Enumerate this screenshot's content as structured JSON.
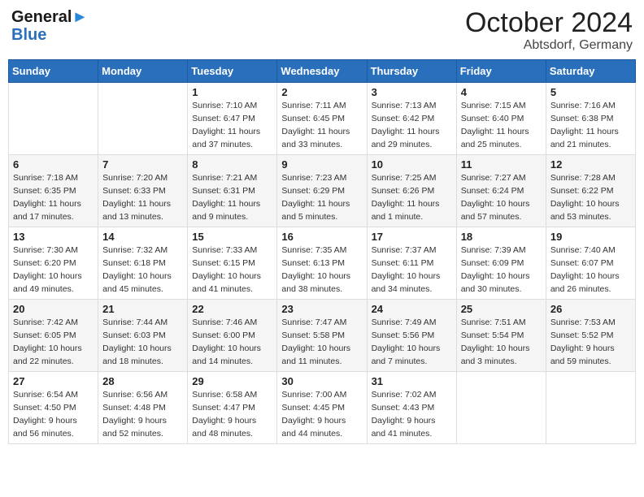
{
  "header": {
    "logo_general": "General",
    "logo_blue": "Blue",
    "month": "October 2024",
    "location": "Abtsdorf, Germany"
  },
  "weekdays": [
    "Sunday",
    "Monday",
    "Tuesday",
    "Wednesday",
    "Thursday",
    "Friday",
    "Saturday"
  ],
  "weeks": [
    [
      null,
      null,
      {
        "day": "1",
        "sunrise": "Sunrise: 7:10 AM",
        "sunset": "Sunset: 6:47 PM",
        "daylight": "Daylight: 11 hours and 37 minutes."
      },
      {
        "day": "2",
        "sunrise": "Sunrise: 7:11 AM",
        "sunset": "Sunset: 6:45 PM",
        "daylight": "Daylight: 11 hours and 33 minutes."
      },
      {
        "day": "3",
        "sunrise": "Sunrise: 7:13 AM",
        "sunset": "Sunset: 6:42 PM",
        "daylight": "Daylight: 11 hours and 29 minutes."
      },
      {
        "day": "4",
        "sunrise": "Sunrise: 7:15 AM",
        "sunset": "Sunset: 6:40 PM",
        "daylight": "Daylight: 11 hours and 25 minutes."
      },
      {
        "day": "5",
        "sunrise": "Sunrise: 7:16 AM",
        "sunset": "Sunset: 6:38 PM",
        "daylight": "Daylight: 11 hours and 21 minutes."
      }
    ],
    [
      {
        "day": "6",
        "sunrise": "Sunrise: 7:18 AM",
        "sunset": "Sunset: 6:35 PM",
        "daylight": "Daylight: 11 hours and 17 minutes."
      },
      {
        "day": "7",
        "sunrise": "Sunrise: 7:20 AM",
        "sunset": "Sunset: 6:33 PM",
        "daylight": "Daylight: 11 hours and 13 minutes."
      },
      {
        "day": "8",
        "sunrise": "Sunrise: 7:21 AM",
        "sunset": "Sunset: 6:31 PM",
        "daylight": "Daylight: 11 hours and 9 minutes."
      },
      {
        "day": "9",
        "sunrise": "Sunrise: 7:23 AM",
        "sunset": "Sunset: 6:29 PM",
        "daylight": "Daylight: 11 hours and 5 minutes."
      },
      {
        "day": "10",
        "sunrise": "Sunrise: 7:25 AM",
        "sunset": "Sunset: 6:26 PM",
        "daylight": "Daylight: 11 hours and 1 minute."
      },
      {
        "day": "11",
        "sunrise": "Sunrise: 7:27 AM",
        "sunset": "Sunset: 6:24 PM",
        "daylight": "Daylight: 10 hours and 57 minutes."
      },
      {
        "day": "12",
        "sunrise": "Sunrise: 7:28 AM",
        "sunset": "Sunset: 6:22 PM",
        "daylight": "Daylight: 10 hours and 53 minutes."
      }
    ],
    [
      {
        "day": "13",
        "sunrise": "Sunrise: 7:30 AM",
        "sunset": "Sunset: 6:20 PM",
        "daylight": "Daylight: 10 hours and 49 minutes."
      },
      {
        "day": "14",
        "sunrise": "Sunrise: 7:32 AM",
        "sunset": "Sunset: 6:18 PM",
        "daylight": "Daylight: 10 hours and 45 minutes."
      },
      {
        "day": "15",
        "sunrise": "Sunrise: 7:33 AM",
        "sunset": "Sunset: 6:15 PM",
        "daylight": "Daylight: 10 hours and 41 minutes."
      },
      {
        "day": "16",
        "sunrise": "Sunrise: 7:35 AM",
        "sunset": "Sunset: 6:13 PM",
        "daylight": "Daylight: 10 hours and 38 minutes."
      },
      {
        "day": "17",
        "sunrise": "Sunrise: 7:37 AM",
        "sunset": "Sunset: 6:11 PM",
        "daylight": "Daylight: 10 hours and 34 minutes."
      },
      {
        "day": "18",
        "sunrise": "Sunrise: 7:39 AM",
        "sunset": "Sunset: 6:09 PM",
        "daylight": "Daylight: 10 hours and 30 minutes."
      },
      {
        "day": "19",
        "sunrise": "Sunrise: 7:40 AM",
        "sunset": "Sunset: 6:07 PM",
        "daylight": "Daylight: 10 hours and 26 minutes."
      }
    ],
    [
      {
        "day": "20",
        "sunrise": "Sunrise: 7:42 AM",
        "sunset": "Sunset: 6:05 PM",
        "daylight": "Daylight: 10 hours and 22 minutes."
      },
      {
        "day": "21",
        "sunrise": "Sunrise: 7:44 AM",
        "sunset": "Sunset: 6:03 PM",
        "daylight": "Daylight: 10 hours and 18 minutes."
      },
      {
        "day": "22",
        "sunrise": "Sunrise: 7:46 AM",
        "sunset": "Sunset: 6:00 PM",
        "daylight": "Daylight: 10 hours and 14 minutes."
      },
      {
        "day": "23",
        "sunrise": "Sunrise: 7:47 AM",
        "sunset": "Sunset: 5:58 PM",
        "daylight": "Daylight: 10 hours and 11 minutes."
      },
      {
        "day": "24",
        "sunrise": "Sunrise: 7:49 AM",
        "sunset": "Sunset: 5:56 PM",
        "daylight": "Daylight: 10 hours and 7 minutes."
      },
      {
        "day": "25",
        "sunrise": "Sunrise: 7:51 AM",
        "sunset": "Sunset: 5:54 PM",
        "daylight": "Daylight: 10 hours and 3 minutes."
      },
      {
        "day": "26",
        "sunrise": "Sunrise: 7:53 AM",
        "sunset": "Sunset: 5:52 PM",
        "daylight": "Daylight: 9 hours and 59 minutes."
      }
    ],
    [
      {
        "day": "27",
        "sunrise": "Sunrise: 6:54 AM",
        "sunset": "Sunset: 4:50 PM",
        "daylight": "Daylight: 9 hours and 56 minutes."
      },
      {
        "day": "28",
        "sunrise": "Sunrise: 6:56 AM",
        "sunset": "Sunset: 4:48 PM",
        "daylight": "Daylight: 9 hours and 52 minutes."
      },
      {
        "day": "29",
        "sunrise": "Sunrise: 6:58 AM",
        "sunset": "Sunset: 4:47 PM",
        "daylight": "Daylight: 9 hours and 48 minutes."
      },
      {
        "day": "30",
        "sunrise": "Sunrise: 7:00 AM",
        "sunset": "Sunset: 4:45 PM",
        "daylight": "Daylight: 9 hours and 44 minutes."
      },
      {
        "day": "31",
        "sunrise": "Sunrise: 7:02 AM",
        "sunset": "Sunset: 4:43 PM",
        "daylight": "Daylight: 9 hours and 41 minutes."
      },
      null,
      null
    ]
  ]
}
